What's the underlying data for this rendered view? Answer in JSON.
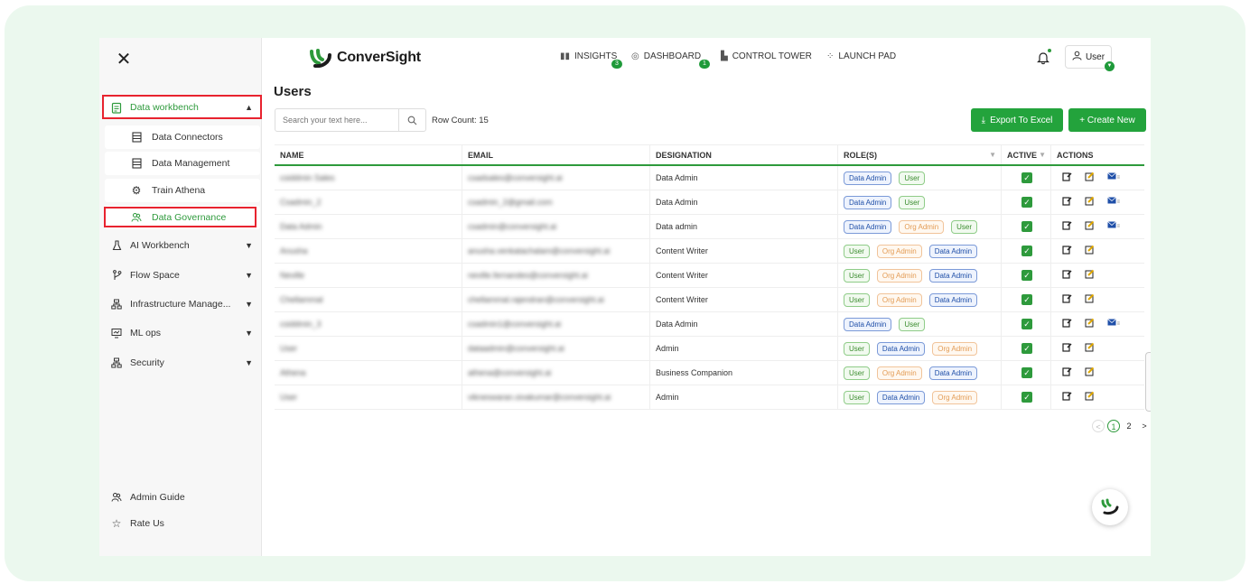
{
  "sidebar": {
    "close_glyph": "✕",
    "items": [
      {
        "label": "Data workbench",
        "icon": "clipboard-icon"
      },
      {
        "label": "Data Connectors",
        "icon": "document-icon"
      },
      {
        "label": "Data Management",
        "icon": "document-icon"
      },
      {
        "label": "Train Athena",
        "icon": "gear-icon"
      },
      {
        "label": "Data Governance",
        "icon": "people-icon"
      },
      {
        "label": "AI Workbench",
        "icon": "flask-icon"
      },
      {
        "label": "Flow Space",
        "icon": "branch-icon"
      },
      {
        "label": "Infrastructure Manage...",
        "icon": "network-icon"
      },
      {
        "label": "ML ops",
        "icon": "monitor-icon"
      },
      {
        "label": "Security",
        "icon": "network-icon"
      }
    ],
    "bottom": [
      {
        "label": "Admin Guide",
        "icon": "people-icon"
      },
      {
        "label": "Rate Us",
        "icon": "star-icon"
      }
    ]
  },
  "header": {
    "logo_text": "ConverSight",
    "nav": [
      {
        "label": "INSIGHTS",
        "badge": "3"
      },
      {
        "label": "DASHBOARD",
        "badge": "1"
      },
      {
        "label": "CONTROL TOWER",
        "badge": ""
      },
      {
        "label": "LAUNCH PAD",
        "badge": ""
      }
    ],
    "user_label": "User"
  },
  "main": {
    "title": "Users",
    "search_placeholder": "Search your text here...",
    "row_count": "Row Count: 15",
    "export_label": "Export To Excel",
    "create_label": "+ Create New"
  },
  "table": {
    "columns": [
      "NAME",
      "EMAIL",
      "DESIGNATION",
      "ROLE(S)",
      "ACTIVE",
      "ACTIONS"
    ],
    "rows": [
      {
        "name": "csiddmin Sales",
        "email": "csadsales@conversight.ai",
        "designation": "Data Admin",
        "roles": [
          "Data Admin",
          "User"
        ],
        "mail": true
      },
      {
        "name": "Csadmin_2",
        "email": "csadmin_2@gmail.com",
        "designation": "Data Admin",
        "roles": [
          "Data Admin",
          "User"
        ],
        "mail": true
      },
      {
        "name": "Data Admin",
        "email": "csadmin@conversight.ai",
        "designation": "Data admin",
        "roles": [
          "Data Admin",
          "Org Admin",
          "User"
        ],
        "mail": true
      },
      {
        "name": "Anusha",
        "email": "anusha.venkatachalam@conversight.ai",
        "designation": "Content Writer",
        "roles": [
          "User",
          "Org Admin",
          "Data Admin"
        ],
        "mail": false
      },
      {
        "name": "Neville",
        "email": "neville.fernandes@conversight.ai",
        "designation": "Content Writer",
        "roles": [
          "User",
          "Org Admin",
          "Data Admin"
        ],
        "mail": false
      },
      {
        "name": "Chellammal",
        "email": "chellammal.rajendran@conversight.ai",
        "designation": "Content Writer",
        "roles": [
          "User",
          "Org Admin",
          "Data Admin"
        ],
        "mail": false
      },
      {
        "name": "csiddmin_3",
        "email": "csadmin1@conversight.ai",
        "designation": "Data Admin",
        "roles": [
          "Data Admin",
          "User"
        ],
        "mail": true
      },
      {
        "name": "User",
        "email": "dataadmin@conversight.ai",
        "designation": "Admin",
        "roles": [
          "User",
          "Data Admin",
          "Org Admin"
        ],
        "mail": false
      },
      {
        "name": "Athena",
        "email": "athena@conversight.ai",
        "designation": "Business Companion",
        "roles": [
          "User",
          "Org Admin",
          "Data Admin"
        ],
        "mail": false
      },
      {
        "name": "User",
        "email": "vikneswaran.sivakumar@conversight.ai",
        "designation": "Admin",
        "roles": [
          "User",
          "Data Admin",
          "Org Admin"
        ],
        "mail": false
      }
    ]
  },
  "pagination": {
    "prev": "<",
    "pages": [
      "1",
      "2"
    ],
    "next": ">"
  },
  "colors": {
    "accent": "#2e9a3c",
    "highlight_box": "#e8232f",
    "frame_bg": "#ebf8ee"
  }
}
